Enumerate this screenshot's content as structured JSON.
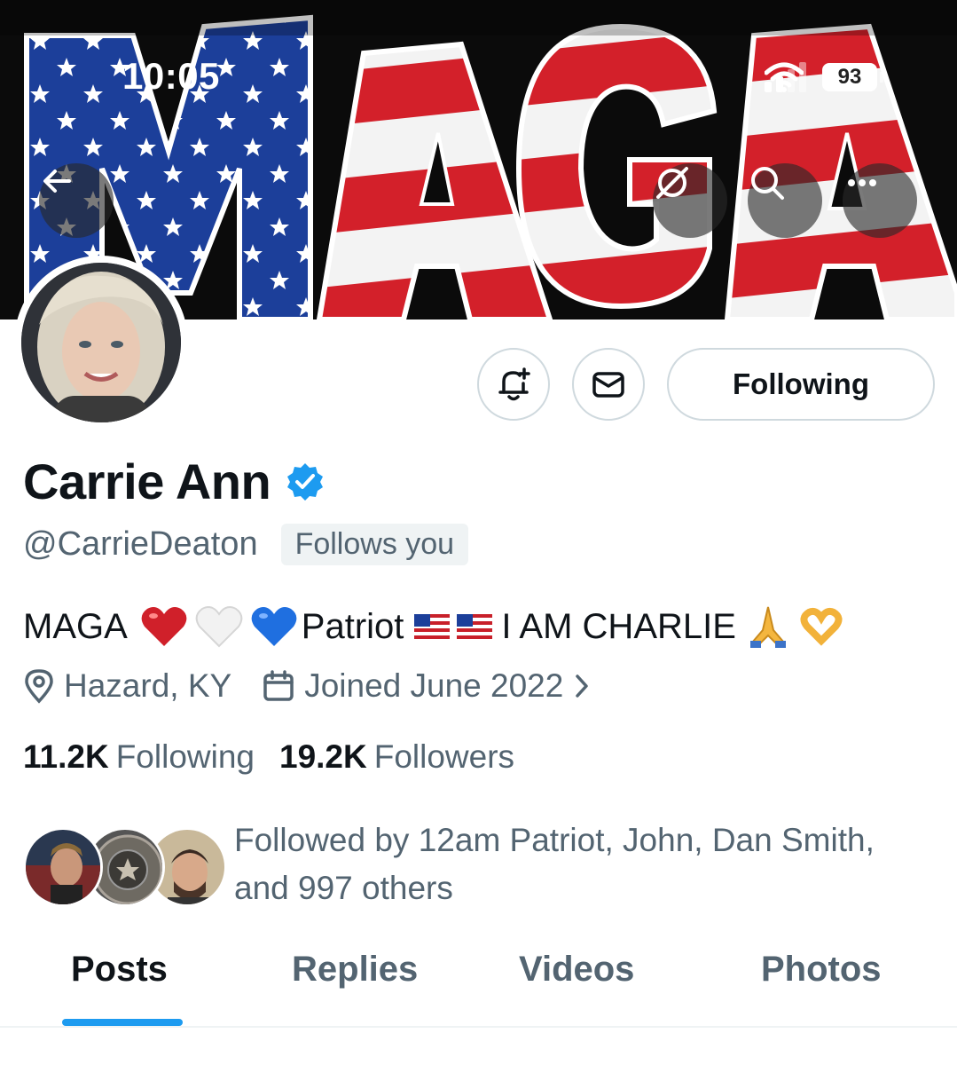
{
  "status_bar": {
    "time": "10:05",
    "battery": "93"
  },
  "header": {
    "back_icon": "arrow-left-icon",
    "grok_icon": "grok-slash-icon",
    "search_icon": "search-icon",
    "more_icon": "more-horizontal-icon"
  },
  "banner": {
    "text": "MAGA"
  },
  "actions": {
    "notify_icon": "bell-plus-icon",
    "message_icon": "envelope-icon",
    "following_label": "Following"
  },
  "profile": {
    "name": "Carrie Ann",
    "verified_icon": "verified-badge-icon",
    "handle": "@CarrieDeaton",
    "follows_you": "Follows you",
    "bio_start": "MAGA",
    "bio_mid": "Patriot",
    "bio_end": "I AM CHARLIE",
    "location": "Hazard, KY",
    "joined": "Joined June 2022"
  },
  "stats": {
    "following_count": "11.2K",
    "following_label": "Following",
    "followers_count": "19.2K",
    "followers_label": "Followers"
  },
  "followed_by": {
    "text": "Followed by 12am Patriot, John, Dan Smith, and 997 others"
  },
  "tabs": [
    {
      "label": "Posts",
      "active": true
    },
    {
      "label": "Replies",
      "active": false
    },
    {
      "label": "Videos",
      "active": false
    },
    {
      "label": "Photos",
      "active": false
    }
  ],
  "colors": {
    "accent": "#1d9bf0",
    "text_primary": "#0f1419",
    "text_secondary": "#536471",
    "border": "#cfd9de",
    "flag_red": "#d3202a",
    "flag_blue": "#1c3f9a"
  }
}
